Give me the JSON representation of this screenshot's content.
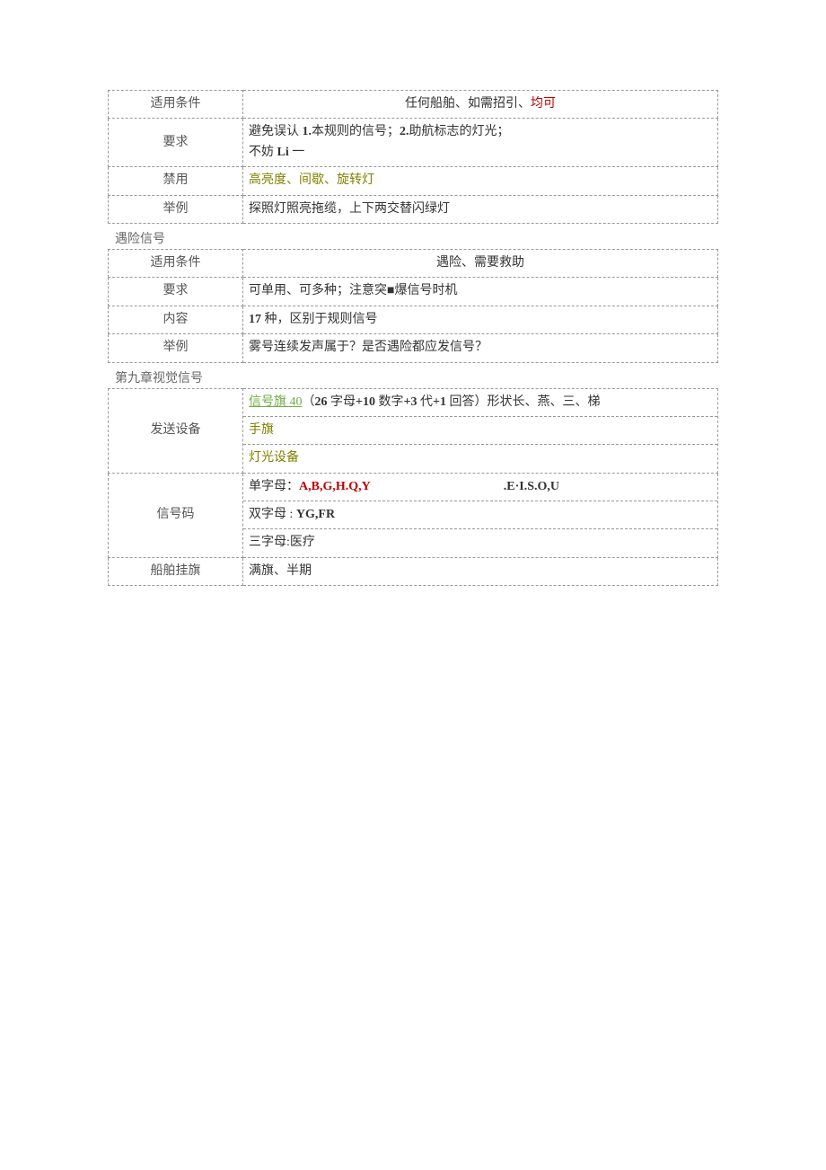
{
  "table1": {
    "rows": [
      {
        "label": "适用条件",
        "parts": [
          {
            "t": "任何船舶、如需招引、"
          },
          {
            "t": "均可",
            "cls": "red"
          }
        ],
        "center": true
      },
      {
        "label": "要求",
        "parts": [
          {
            "t": "避免误认 "
          },
          {
            "t": "1.",
            "cls": "bold"
          },
          {
            "t": "本规则的信号；"
          },
          {
            "t": "2.",
            "cls": "bold"
          },
          {
            "t": "助航标志的灯光；\n不妨 "
          },
          {
            "t": "Li",
            "cls": "bold"
          },
          {
            "t": " 一"
          }
        ]
      },
      {
        "label": "禁用",
        "parts": [
          {
            "t": "高亮度、间歇、旋转灯",
            "cls": "olive"
          }
        ]
      },
      {
        "label": "举例",
        "parts": [
          {
            "t": "探照灯照亮拖缆，上下两交替闪绿灯"
          }
        ]
      }
    ]
  },
  "section2_title": "遇险信号",
  "table2": {
    "rows": [
      {
        "label": "适用条件",
        "parts": [
          {
            "t": "遇险、需要救助"
          }
        ],
        "center": true
      },
      {
        "label": "要求",
        "parts": [
          {
            "t": "可单用、可多种；注意突■爆信号时机"
          }
        ]
      },
      {
        "label": "内容",
        "parts": [
          {
            "t": "17 ",
            "cls": "bold"
          },
          {
            "t": "种，区别于规则信号"
          }
        ]
      },
      {
        "label": "举例",
        "parts": [
          {
            "t": "雾号连续发声属于？是否遇险都应发信号？"
          }
        ]
      }
    ]
  },
  "section3_title": "第九章视觉信号",
  "table3": {
    "sending": {
      "label": "发送设备",
      "lines": [
        [
          {
            "t": "信号旗 40",
            "cls": "green-underline"
          },
          {
            "t": "（"
          },
          {
            "t": "26 ",
            "cls": "bold"
          },
          {
            "t": "字母"
          },
          {
            "t": "+10 ",
            "cls": "bold"
          },
          {
            "t": "数字"
          },
          {
            "t": "+3 ",
            "cls": "bold"
          },
          {
            "t": "代"
          },
          {
            "t": "+1 ",
            "cls": "bold"
          },
          {
            "t": "回答）形状长、燕、三、梯"
          }
        ],
        [
          {
            "t": "手旗",
            "cls": "olive"
          }
        ],
        [
          {
            "t": "灯光设备",
            "cls": "olive"
          }
        ]
      ]
    },
    "code": {
      "label": "信号码",
      "lines": [
        {
          "dual": true,
          "left": [
            {
              "t": "单字母："
            },
            {
              "t": "A,B,G,H.Q,Y",
              "cls": "bold red"
            }
          ],
          "right": [
            {
              "t": ".E·I.S.O,U",
              "cls": "bold"
            }
          ]
        },
        [
          {
            "t": "双字母 : "
          },
          {
            "t": "YG,FR",
            "cls": "bold"
          }
        ],
        [
          {
            "t": "三字母:医疗"
          }
        ]
      ]
    },
    "flag": {
      "label": "船舶挂旗",
      "parts": [
        {
          "t": "满旗、半期"
        }
      ]
    }
  }
}
